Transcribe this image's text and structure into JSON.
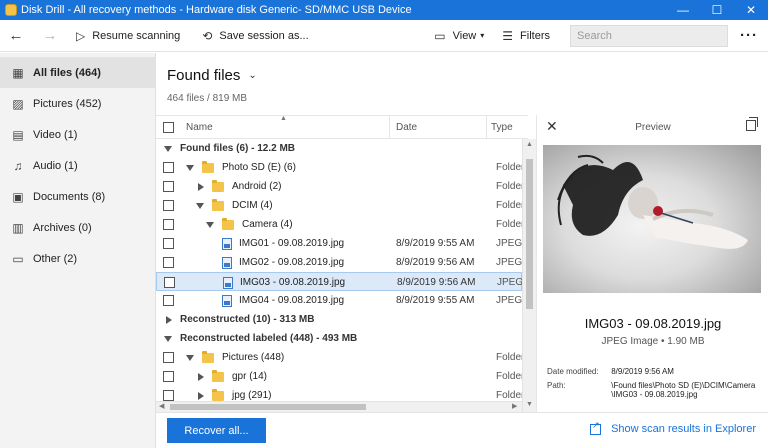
{
  "window": {
    "title": "Disk Drill - All recovery methods - Hardware disk Generic- SD/MMC USB Device"
  },
  "toolbar": {
    "resume_label": "Resume scanning",
    "save_label": "Save session as...",
    "view_label": "View",
    "filters_label": "Filters",
    "search_placeholder": "Search"
  },
  "sidebar": {
    "items": [
      {
        "label": "All files (464)",
        "icon": "all-files-icon",
        "active": true
      },
      {
        "label": "Pictures (452)",
        "icon": "pictures-icon"
      },
      {
        "label": "Video (1)",
        "icon": "video-icon"
      },
      {
        "label": "Audio (1)",
        "icon": "audio-icon"
      },
      {
        "label": "Documents (8)",
        "icon": "documents-icon"
      },
      {
        "label": "Archives (0)",
        "icon": "archives-icon"
      },
      {
        "label": "Other (2)",
        "icon": "other-icon"
      }
    ]
  },
  "main": {
    "title": "Found files",
    "subtitle": "464 files / 819 MB"
  },
  "list": {
    "columns": {
      "name": "Name",
      "date": "Date",
      "type": "Type"
    },
    "rows": [
      {
        "label": "Found files (6) - 12.2 MB",
        "kind": "group",
        "expanded": true,
        "indent": 0
      },
      {
        "label": "Photo SD (E) (6)",
        "kind": "folder",
        "expanded": true,
        "indent": 1,
        "type": "Folder"
      },
      {
        "label": "Android (2)",
        "kind": "folder",
        "expanded": false,
        "indent": 2,
        "type": "Folder"
      },
      {
        "label": "DCIM (4)",
        "kind": "folder",
        "expanded": true,
        "indent": 2,
        "type": "Folder"
      },
      {
        "label": "Camera (4)",
        "kind": "folder",
        "expanded": true,
        "indent": 3,
        "type": "Folder"
      },
      {
        "label": "IMG01 - 09.08.2019.jpg",
        "kind": "file",
        "indent": 4,
        "date": "8/9/2019 9:55 AM",
        "type": "JPEG Im"
      },
      {
        "label": "IMG02 - 09.08.2019.jpg",
        "kind": "file",
        "indent": 4,
        "date": "8/9/2019 9:56 AM",
        "type": "JPEG Im"
      },
      {
        "label": "IMG03 - 09.08.2019.jpg",
        "kind": "file",
        "indent": 4,
        "date": "8/9/2019 9:56 AM",
        "type": "JPEG Im",
        "selected": true
      },
      {
        "label": "IMG04 - 09.08.2019.jpg",
        "kind": "file",
        "indent": 4,
        "date": "8/9/2019 9:55 AM",
        "type": "JPEG Im"
      },
      {
        "label": "Reconstructed (10) - 313 MB",
        "kind": "group",
        "expanded": false,
        "indent": 0
      },
      {
        "label": "Reconstructed labeled (448) - 493 MB",
        "kind": "group",
        "expanded": true,
        "indent": 0
      },
      {
        "label": "Pictures (448)",
        "kind": "folder",
        "expanded": true,
        "indent": 1,
        "type": "Folder"
      },
      {
        "label": "gpr (14)",
        "kind": "folder",
        "expanded": false,
        "indent": 2,
        "type": "Folder"
      },
      {
        "label": "jpg (291)",
        "kind": "folder",
        "expanded": false,
        "indent": 2,
        "type": "Folder"
      }
    ]
  },
  "preview": {
    "title": "Preview",
    "file_name": "IMG03 - 09.08.2019.jpg",
    "meta": "JPEG Image • 1.90 MB",
    "date_modified_label": "Date modified:",
    "date_modified": "8/9/2019 9:56 AM",
    "path_label": "Path:",
    "path_line1": "\\Found files\\Photo SD (E)\\DCIM\\Camera",
    "path_line2": "\\IMG03 - 09.08.2019.jpg"
  },
  "bottom": {
    "recover_label": "Recover all...",
    "show_results_label": "Show scan results in Explorer"
  },
  "colors": {
    "accent": "#1a73d9",
    "selection": "#dbe9f8",
    "folder": "#f3c34a"
  }
}
